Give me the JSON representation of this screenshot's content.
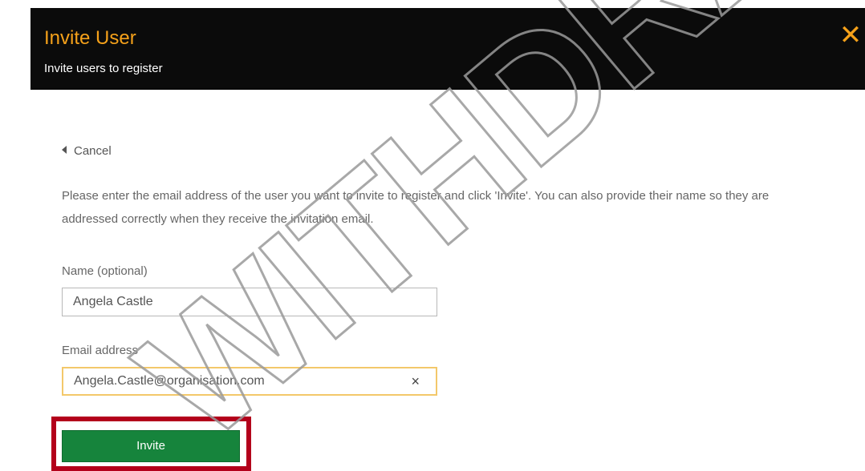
{
  "header": {
    "title": "Invite User",
    "subtitle": "Invite users to register",
    "close_icon": "close-icon"
  },
  "cancel": {
    "label": "Cancel"
  },
  "instructions": "Please enter the email address of the user you want to invite to register and click 'Invite'. You can also provide their name so they are addressed correctly when they receive the invitation email.",
  "form": {
    "name_label": "Name (optional)",
    "name_value": "Angela Castle",
    "email_label": "Email address",
    "email_value": "Angela.Castle@organisation.com",
    "clear_glyph": "×"
  },
  "invite_button": {
    "label": "Invite"
  },
  "watermark": {
    "text": "WITHDRAWN"
  },
  "colors": {
    "header_bg": "#0b0b0b",
    "accent": "#f5a11a",
    "button": "#16843c",
    "highlight": "#b3001b"
  }
}
